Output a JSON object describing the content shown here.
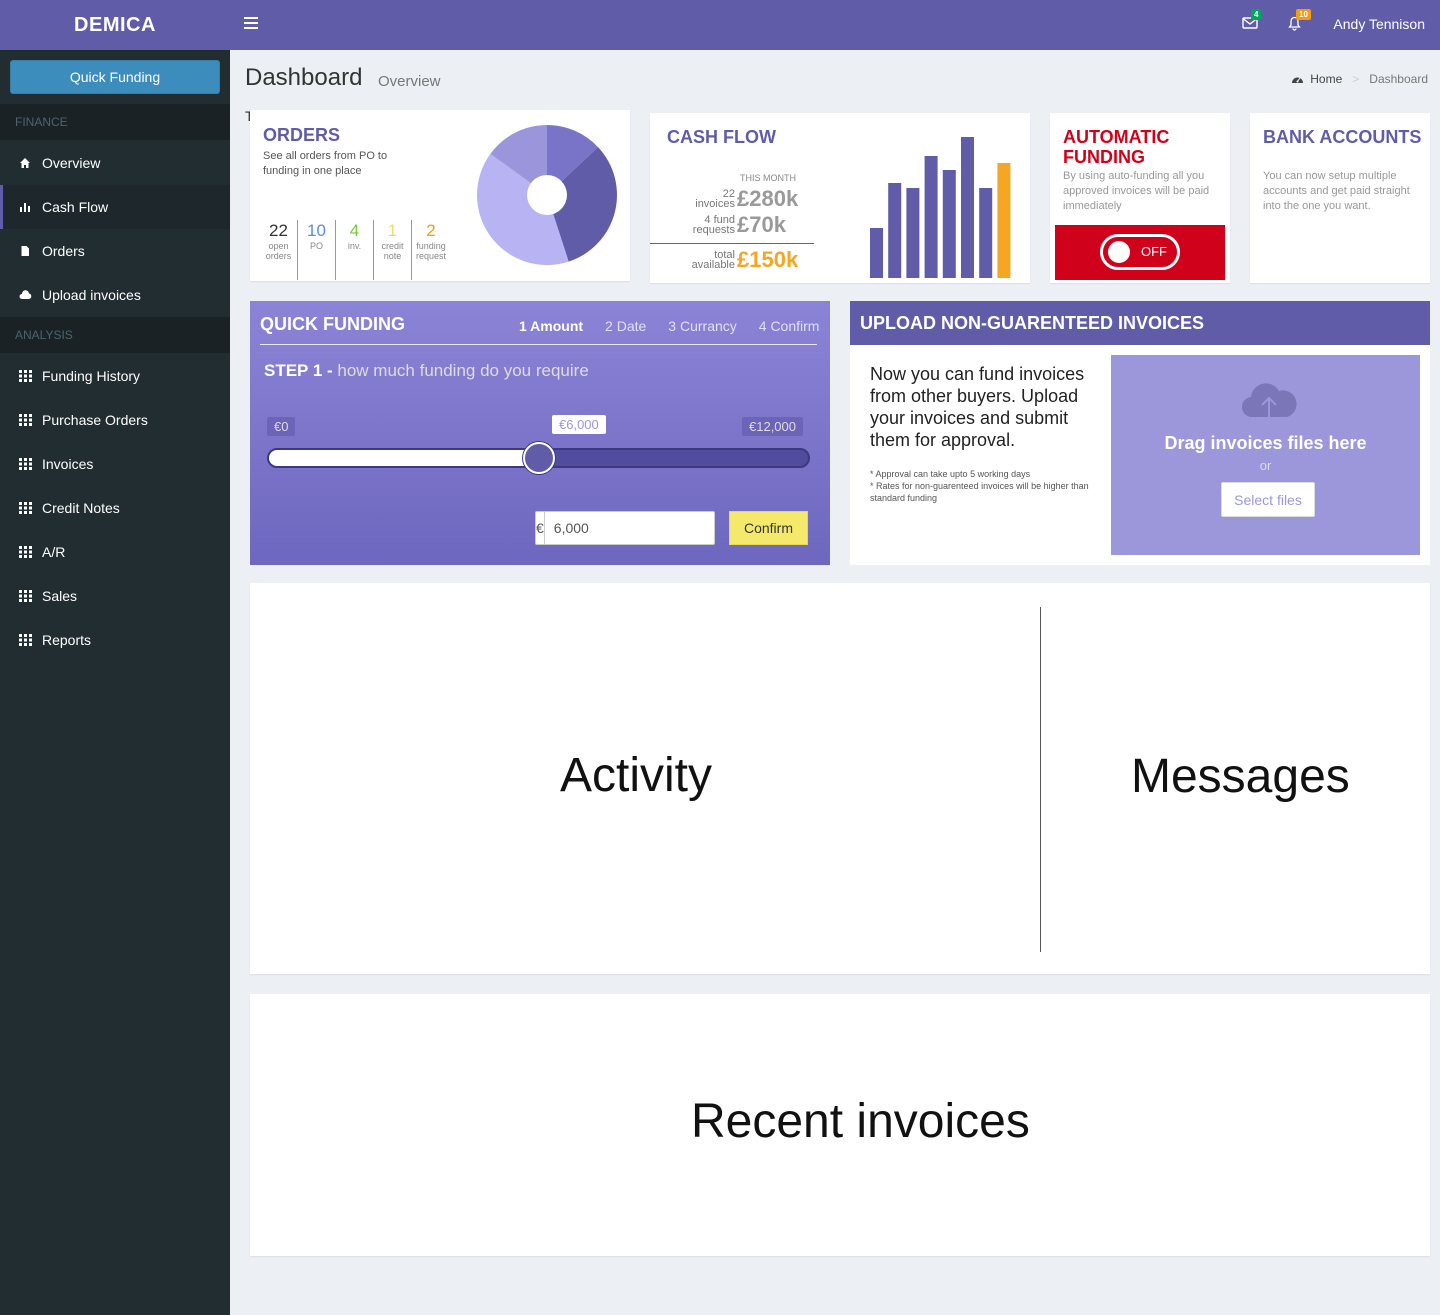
{
  "brand": "DEMICA",
  "sidebar": {
    "quick_funding_label": "Quick Funding",
    "sections": [
      {
        "header": "FINANCE",
        "items": [
          {
            "label": "Overview",
            "icon": "home-icon"
          },
          {
            "label": "Cash Flow",
            "icon": "bar-chart-icon",
            "active": true
          },
          {
            "label": "Orders",
            "icon": "document-icon"
          },
          {
            "label": "Upload invoices",
            "icon": "cloud-upload-icon"
          }
        ]
      },
      {
        "header": "ANALYSIS",
        "items": [
          {
            "label": "Funding History",
            "icon": "grid-icon"
          },
          {
            "label": "Purchase Orders",
            "icon": "grid-icon"
          },
          {
            "label": "Invoices",
            "icon": "grid-icon"
          },
          {
            "label": "Credit Notes",
            "icon": "grid-icon"
          },
          {
            "label": "A/R",
            "icon": "grid-icon"
          },
          {
            "label": "Sales",
            "icon": "grid-icon"
          },
          {
            "label": "Reports",
            "icon": "grid-icon"
          }
        ]
      }
    ]
  },
  "topbar": {
    "messages_count": "4",
    "notifications_count": "10",
    "user_name": "Andy Tennison",
    "colors": {
      "messages_badge": "#00a65a",
      "notifications_badge": "#f39c12"
    }
  },
  "page": {
    "title": "Dashboard",
    "subtitle": "Overview",
    "stray_text": "T",
    "breadcrumb": {
      "home": "Home",
      "current": "Dashboard"
    }
  },
  "orders": {
    "title": "ORDERS",
    "description": "See all orders from PO to funding in one place",
    "stats": [
      {
        "value": "22",
        "label": "open orders",
        "color": "#333333"
      },
      {
        "value": "10",
        "label": "PO",
        "color": "#5b8fd6"
      },
      {
        "value": "4",
        "label": "inv.",
        "color": "#7ac943"
      },
      {
        "value": "1",
        "label": "credit note",
        "color": "#f5d76e"
      },
      {
        "value": "2",
        "label": "funding request",
        "color": "#f39c12"
      }
    ],
    "pie_colors": [
      "#7a74c9",
      "#605ca8",
      "#b8b4f3",
      "#9b96dc"
    ],
    "pie_shares": [
      0.13,
      0.32,
      0.4,
      0.15
    ]
  },
  "cash_flow": {
    "title": "CASH FLOW",
    "period_label": "THIS MONTH",
    "invoices_label": "22 invoices",
    "invoices_value": "£280k",
    "requests_label": "4 fund requests",
    "requests_value": "£70k",
    "available_label": "total available",
    "available_value": "£150k",
    "bar_values": [
      50,
      95,
      90,
      122,
      108,
      141,
      90,
      115
    ],
    "bar_color": "#605ca8",
    "highlight_color": "#f5a623"
  },
  "auto_funding": {
    "title": "AUTOMATIC FUNDING",
    "description": "By using auto-funding all you approved invoices will be paid immediately",
    "toggle_label": "OFF",
    "color": "#d0021b"
  },
  "bank_accounts": {
    "title": "BANK ACCOUNTS",
    "description": "You can now setup multiple accounts and get paid straight into the one you want."
  },
  "quick_funding": {
    "title": "QUICK FUNDING",
    "steps": [
      "1 Amount",
      "2 Date",
      "3 Currancy",
      "4 Confirm"
    ],
    "step_heading": "STEP 1 -",
    "step_text": "how much funding do you require",
    "min_label": "€0",
    "mid_label": "€6,000",
    "max_label": "€12,000",
    "slider_fraction": 0.5,
    "currency_symbol": "€",
    "amount_value": "6,000",
    "confirm_label": "Confirm"
  },
  "upload": {
    "title": "UPLOAD NON-GUARENTEED INVOICES",
    "text": "Now you can fund invoices from other buyers. Upload your invoices and submit them for approval.",
    "note1": "* Approval can take upto 5 working days",
    "note2": "* Rates for non-guarenteed invoices will be higher than standard funding",
    "drop_title": "Drag invoices files here",
    "or": "or",
    "select_files": "Select files"
  },
  "panels": {
    "activity": "Activity",
    "messages": "Messages",
    "recent_invoices": "Recent invoices"
  }
}
